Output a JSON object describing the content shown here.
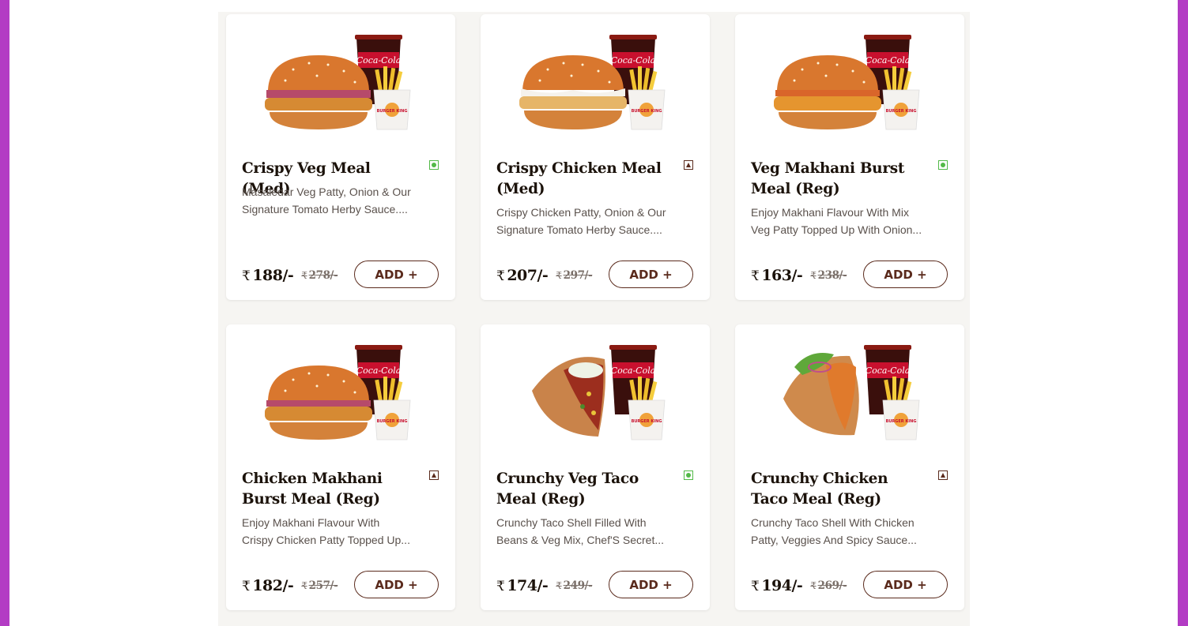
{
  "items": [
    {
      "name": "Crispy Veg Meal (Med)",
      "diet": "veg",
      "desc1": "Masaledar Veg Patty, Onion & Our",
      "desc2": "Signature Tomato Herby Sauce....",
      "currency": "₹",
      "price": "188/-",
      "mrp": "278/-",
      "add_label": "ADD +"
    },
    {
      "name": "Crispy Chicken Meal (Med)",
      "diet": "nonveg",
      "desc1": "Crispy Chicken Patty, Onion & Our",
      "desc2": "Signature Tomato Herby Sauce....",
      "currency": "₹",
      "price": "207/-",
      "mrp": "297/-",
      "add_label": "ADD +"
    },
    {
      "name": "Veg Makhani Burst Meal (Reg)",
      "diet": "veg",
      "desc1": "Enjoy Makhani Flavour With Mix",
      "desc2": "Veg Patty Topped Up With Onion...",
      "currency": "₹",
      "price": "163/-",
      "mrp": "238/-",
      "add_label": "ADD +"
    },
    {
      "name": "Chicken Makhani Burst Meal (Reg)",
      "diet": "nonveg",
      "desc1": "Enjoy Makhani Flavour With",
      "desc2": "Crispy Chicken Patty Topped Up...",
      "currency": "₹",
      "price": "182/-",
      "mrp": "257/-",
      "add_label": "ADD +"
    },
    {
      "name": "Crunchy Veg Taco Meal (Reg)",
      "diet": "veg",
      "desc1": "Crunchy Taco Shell Filled With",
      "desc2": "Beans & Veg Mix, Chef'S Secret...",
      "currency": "₹",
      "price": "174/-",
      "mrp": "249/-",
      "add_label": "ADD +"
    },
    {
      "name": "Crunchy Chicken Taco Meal (Reg)",
      "diet": "nonveg",
      "desc1": "Crunchy Taco Shell With Chicken",
      "desc2": "Patty, Veggies And Spicy Sauce...",
      "currency": "₹",
      "price": "194/-",
      "mrp": "269/-",
      "add_label": "ADD +"
    }
  ],
  "cup_brand": "Coca-Cola",
  "box_brand": "BURGER KING",
  "colors": {
    "accent": "#5a2a1c",
    "veg": "#52b947",
    "frame": "#b33cc4"
  }
}
